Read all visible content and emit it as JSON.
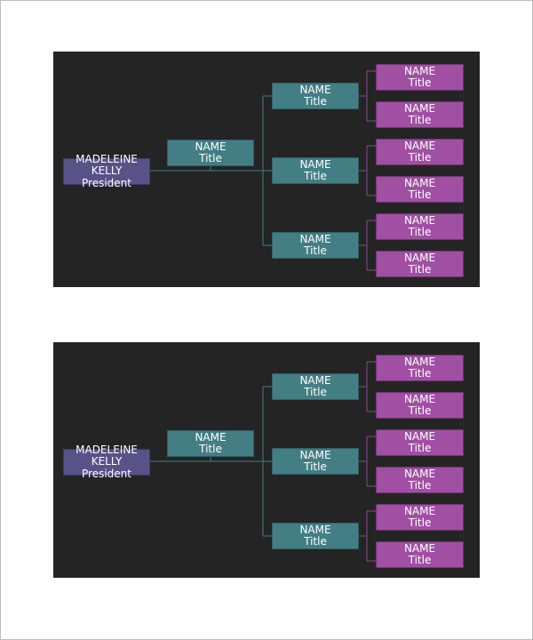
{
  "colors": {
    "page_background": "#ffffff",
    "slide_background": "#242424",
    "president_fill": "#585289",
    "teal_fill": "#437e84",
    "purple_fill": "#a04fa3",
    "teal_line": "#437e84",
    "purple_line": "#8a4a8d"
  },
  "charts": [
    {
      "president": {
        "first": "MADELEINE",
        "last": "KELLY",
        "title": "President"
      },
      "assistant": {
        "name": "NAME",
        "title": "Title"
      },
      "managers": [
        {
          "name": "NAME",
          "title": "Title",
          "reports": [
            {
              "name": "NAME",
              "title": "Title"
            },
            {
              "name": "NAME",
              "title": "Title"
            }
          ]
        },
        {
          "name": "NAME",
          "title": "Title",
          "reports": [
            {
              "name": "NAME",
              "title": "Title"
            },
            {
              "name": "NAME",
              "title": "Title"
            }
          ]
        },
        {
          "name": "NAME",
          "title": "Title",
          "reports": [
            {
              "name": "NAME",
              "title": "Title"
            },
            {
              "name": "NAME",
              "title": "Title"
            }
          ]
        }
      ]
    },
    {
      "president": {
        "first": "MADELEINE",
        "last": "KELLY",
        "title": "President"
      },
      "assistant": {
        "name": "NAME",
        "title": "Title"
      },
      "managers": [
        {
          "name": "NAME",
          "title": "Title",
          "reports": [
            {
              "name": "NAME",
              "title": "Title"
            },
            {
              "name": "NAME",
              "title": "Title"
            }
          ]
        },
        {
          "name": "NAME",
          "title": "Title",
          "reports": [
            {
              "name": "NAME",
              "title": "Title"
            },
            {
              "name": "NAME",
              "title": "Title"
            }
          ]
        },
        {
          "name": "NAME",
          "title": "Title",
          "reports": [
            {
              "name": "NAME",
              "title": "Title"
            },
            {
              "name": "NAME",
              "title": "Title"
            }
          ]
        }
      ]
    }
  ]
}
